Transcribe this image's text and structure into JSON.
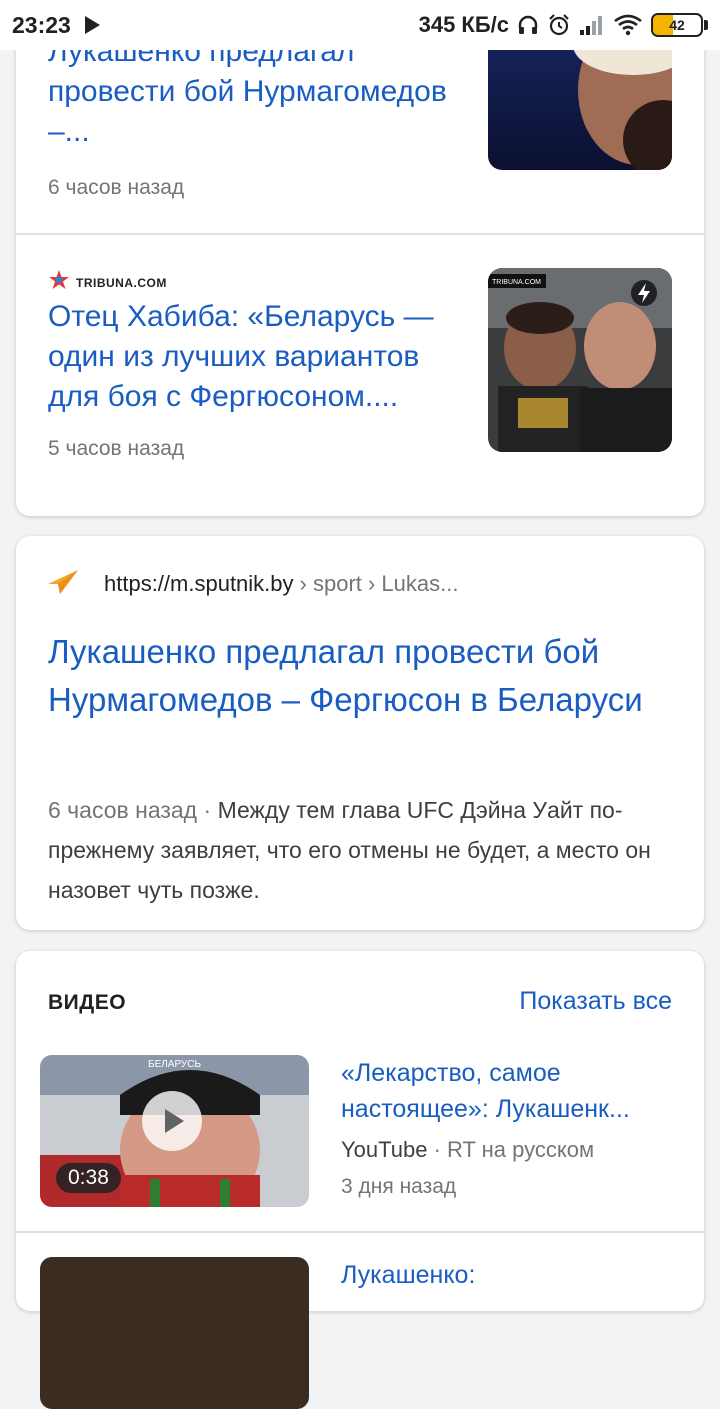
{
  "status_bar": {
    "time": "23:23",
    "speed": "345 КБ/с",
    "battery": "42"
  },
  "news_items": [
    {
      "title_partial": "Лукашенко предлагал провести бой Нурмагомедов –...",
      "time": "6 часов назад"
    },
    {
      "source": "TRIBUNA.COM",
      "title": "Отец Хабиба: «Беларусь — один из лучших вариантов для боя с Фергюсоном....",
      "time": "5 часов назад",
      "thumb_label": "TRIBUNA.COM"
    }
  ],
  "result": {
    "domain": "https://m.sputnik.by",
    "breadcrumb": "› sport › Lukas...",
    "title": "Лукашенко предлагал провести бой Нурмагомедов – Фергюсон в Беларуси",
    "snippet_time": "6 часов назад",
    "snippet_sep": " · ",
    "snippet_text": "Между тем глава UFC Дэйна Уайт по-прежнему заявляет, что его отмены не будет, а место он назовет чуть позже."
  },
  "videos": {
    "header": "ВИДЕО",
    "show_all": "Показать все",
    "items": [
      {
        "title": "«Лекарство, самое настоящее»: Лукашенк...",
        "platform": "YouTube",
        "channel": "RT на русском",
        "time": "3 дня назад",
        "duration": "0:38",
        "thumb_text": "БЕЛАРУСЬ"
      },
      {
        "title": "Лукашенко:"
      }
    ]
  },
  "colors": {
    "link": "#1a5dc2",
    "meta": "#70757a",
    "battery_fill": "#f4b400"
  }
}
